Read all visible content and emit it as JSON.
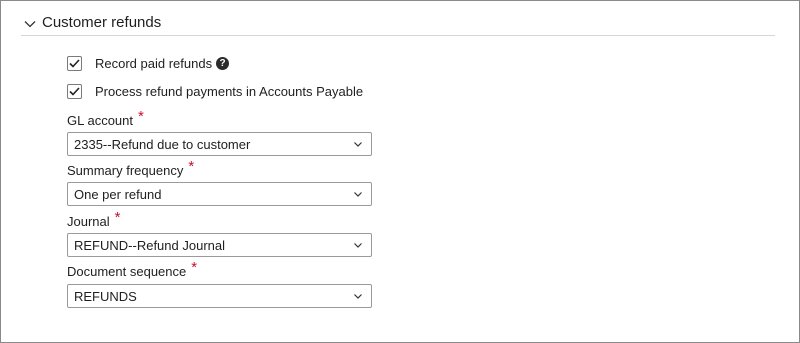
{
  "section": {
    "title": "Customer refunds",
    "toggle_icon": "chevron-down-icon"
  },
  "options": {
    "record_paid_refunds": {
      "label": "Record paid refunds",
      "checked": true,
      "help_icon": "question-circle-icon"
    },
    "process_in_ap": {
      "label": "Process refund payments in Accounts Payable",
      "checked": true
    }
  },
  "fields": {
    "gl_account": {
      "label": "GL account",
      "required_mark": "*",
      "value": "2335--Refund due to customer"
    },
    "summary_frequency": {
      "label": "Summary frequency",
      "required_mark": "*",
      "value": "One per refund"
    },
    "journal": {
      "label": "Journal",
      "required_mark": "*",
      "value": "REFUND--Refund Journal"
    },
    "document_sequence": {
      "label": "Document sequence",
      "required_mark": "*",
      "value": "REFUNDS"
    }
  },
  "colors": {
    "required": "#c8102e",
    "border": "#9a9a9a",
    "divider": "#d6d6d6"
  }
}
